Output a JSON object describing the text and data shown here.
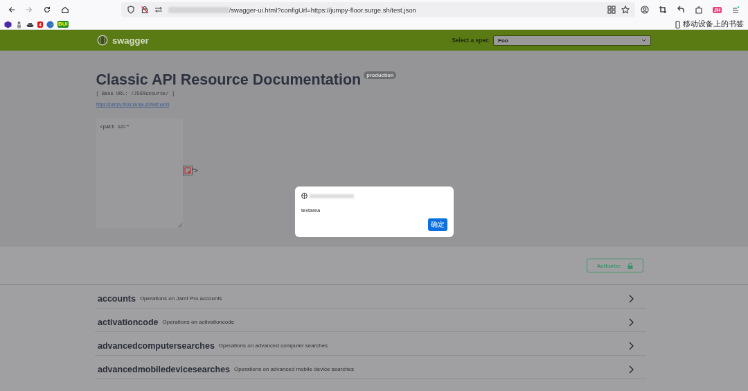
{
  "browser": {
    "nav_buttons": [
      {
        "kind": "back",
        "disabled": false
      },
      {
        "kind": "forward",
        "disabled": true
      },
      {
        "kind": "reload",
        "disabled": false
      },
      {
        "kind": "home",
        "disabled": false
      }
    ],
    "url": "/swagger-ui.html?configUrl=https://jumpy-floor.surge.sh/test.json",
    "profile_badge": "JH",
    "bookmarks": [
      {
        "kind": "cube"
      },
      {
        "kind": "figure"
      },
      {
        "kind": "hat"
      },
      {
        "kind": "badge",
        "text": "4"
      },
      {
        "kind": "globe"
      },
      {
        "kind": "label",
        "text": "BUI"
      }
    ],
    "mobile_bookmarks": "移动设备上的书签"
  },
  "swagger": {
    "logo": "swagger",
    "spec_label": "Select a spec",
    "spec_value": "Foo",
    "title": "Classic API Resource Documentation",
    "version_badge": "production",
    "base_url": "[ Base URL: /JSSResource/ ]",
    "spec_link": "https://jumpy-floor.surge.sh/test.yaml",
    "textarea_value": "<path id=\"",
    "injected_text": "\">",
    "authorize": "Authorize",
    "tags": [
      {
        "name": "accounts",
        "description": "Operations on Jamf Pro accounts"
      },
      {
        "name": "activationcode",
        "description": "Operations on activationcode"
      },
      {
        "name": "advancedcomputersearches",
        "description": "Operations on advanced computer searches"
      },
      {
        "name": "advancedmobiledevicesearches",
        "description": "Operations on advanced mobile device searches"
      }
    ]
  },
  "dialog": {
    "message": "textarea",
    "button": "确定"
  }
}
